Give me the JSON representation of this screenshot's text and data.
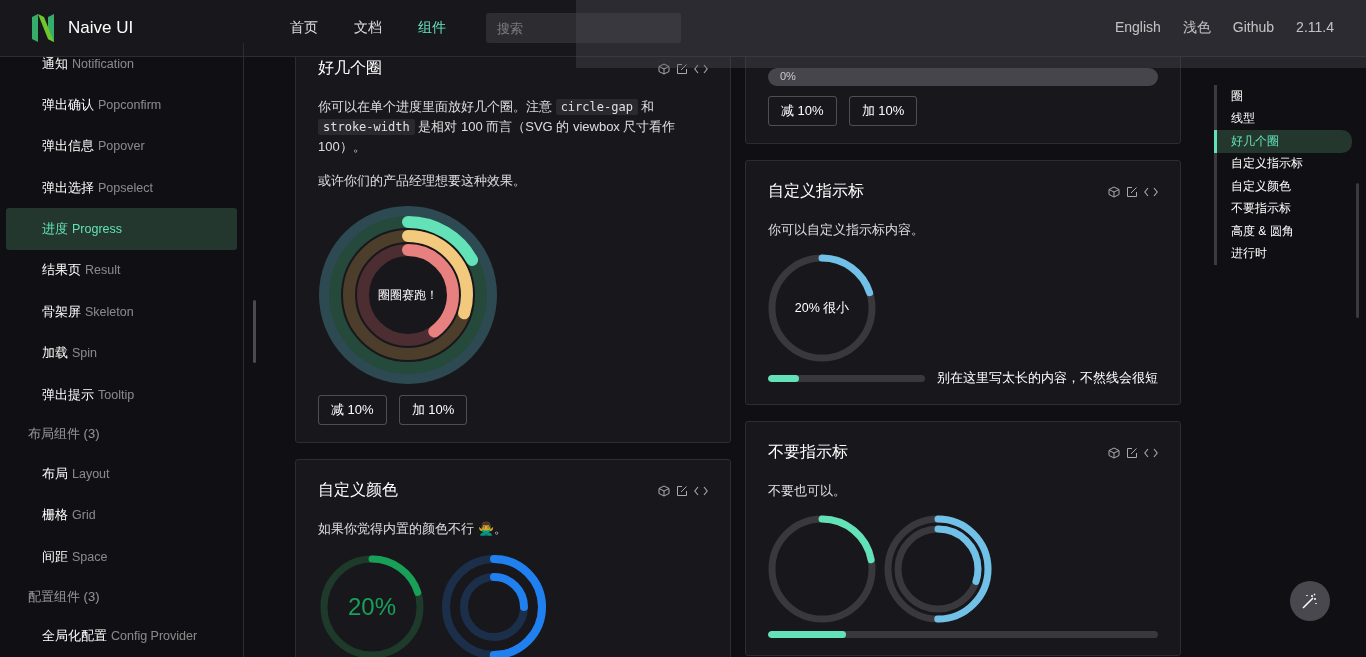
{
  "header": {
    "logo_text": "Naive UI",
    "nav": [
      {
        "label": "首页",
        "selected": false
      },
      {
        "label": "文档",
        "selected": false
      },
      {
        "label": "组件",
        "selected": true
      }
    ],
    "search": {
      "placeholder": "搜索"
    },
    "links": [
      "English",
      "浅色",
      "Github",
      "2.11.4"
    ]
  },
  "sidebar": {
    "items": [
      {
        "kind": "item",
        "zh": "通知",
        "en": "Notification",
        "selected": false
      },
      {
        "kind": "item",
        "zh": "弹出确认",
        "en": "Popconfirm",
        "selected": false
      },
      {
        "kind": "item",
        "zh": "弹出信息",
        "en": "Popover",
        "selected": false
      },
      {
        "kind": "item",
        "zh": "弹出选择",
        "en": "Popselect",
        "selected": false
      },
      {
        "kind": "item",
        "zh": "进度",
        "en": "Progress",
        "selected": true
      },
      {
        "kind": "item",
        "zh": "结果页",
        "en": "Result",
        "selected": false
      },
      {
        "kind": "item",
        "zh": "骨架屏",
        "en": "Skeleton",
        "selected": false
      },
      {
        "kind": "item",
        "zh": "加载",
        "en": "Spin",
        "selected": false
      },
      {
        "kind": "item",
        "zh": "弹出提示",
        "en": "Tooltip",
        "selected": false
      },
      {
        "kind": "group",
        "zh": "布局组件 (3)"
      },
      {
        "kind": "item",
        "zh": "布局",
        "en": "Layout",
        "selected": false
      },
      {
        "kind": "item",
        "zh": "栅格",
        "en": "Grid",
        "selected": false
      },
      {
        "kind": "item",
        "zh": "间距",
        "en": "Space",
        "selected": false
      },
      {
        "kind": "group",
        "zh": "配置组件 (3)"
      },
      {
        "kind": "item",
        "zh": "全局化配置",
        "en": "Config Provider",
        "selected": false
      }
    ]
  },
  "left_column": [
    {
      "kind": "multi_circle",
      "title": "好几个圈",
      "paragraph": [
        {
          "kind": "text",
          "text": "你可以在单个进度里面放好几个圈。注意 "
        },
        {
          "kind": "code",
          "text": "circle-gap"
        },
        {
          "kind": "text",
          "text": " 和 "
        },
        {
          "kind": "code",
          "text": "stroke-width"
        },
        {
          "kind": "text",
          "text": " 是相对 100 而言（SVG 的 viewbox 尺寸看作 100）。"
        }
      ],
      "note": "或许你们的产品经理想要这种效果。",
      "center_text": "圈圈赛跑！",
      "rings": [
        {
          "color": "#63e2b7",
          "level": 0.17
        },
        {
          "color": "#f2c97d",
          "level": 0.3
        },
        {
          "color": "#e88080",
          "level": 0.4
        }
      ],
      "buttons": [
        "减 10%",
        "加 10%"
      ]
    },
    {
      "kind": "custom_color",
      "title": "自定义颜色",
      "paragraph": "如果你觉得内置的颜色不行 🙅‍♂️。",
      "gauge": {
        "color": "#18a058",
        "level": 0.2,
        "text": "20%"
      },
      "arcs": [
        {
          "color": "#2080f0",
          "level": 0.5
        },
        {
          "color": "#2080f0",
          "level": 0.25
        }
      ]
    }
  ],
  "right_column": [
    {
      "kind": "line_buttons",
      "bar": {
        "level": 0,
        "text": "0%"
      },
      "buttons": [
        "减 10%",
        "加 10%"
      ]
    },
    {
      "kind": "indicator",
      "title": "自定义指示标",
      "paragraph": "你可以自定义指示标内容。",
      "circle": {
        "color": "#70c0e8",
        "level": 0.2,
        "text": "20% 很小"
      },
      "bar": {
        "color": "#63e2b7",
        "level": 0.2,
        "text": "别在这里写太长的内容，不然线会很短"
      }
    },
    {
      "kind": "no_indicator",
      "title": "不要指示标",
      "paragraph": "不要也可以。",
      "circle": {
        "color": "#63e2b7",
        "level": 0.22
      },
      "arcs": [
        {
          "color": "#70c0e8",
          "level": 0.5
        },
        {
          "color": "#70c0e8",
          "level": 0.3
        }
      ],
      "bar": {
        "color": "#63e2b7",
        "level": 0.2
      }
    },
    {
      "kind": "empty"
    }
  ],
  "anchor_nav": [
    {
      "label": "圈",
      "selected": false
    },
    {
      "label": "线型",
      "selected": false
    },
    {
      "label": "好几个圈",
      "selected": true
    },
    {
      "label": "自定义指示标",
      "selected": false
    },
    {
      "label": "自定义颜色",
      "selected": false
    },
    {
      "label": "不要指示标",
      "selected": false
    },
    {
      "label": "高度 & 圆角",
      "selected": false
    },
    {
      "label": "进行时",
      "selected": false
    }
  ]
}
